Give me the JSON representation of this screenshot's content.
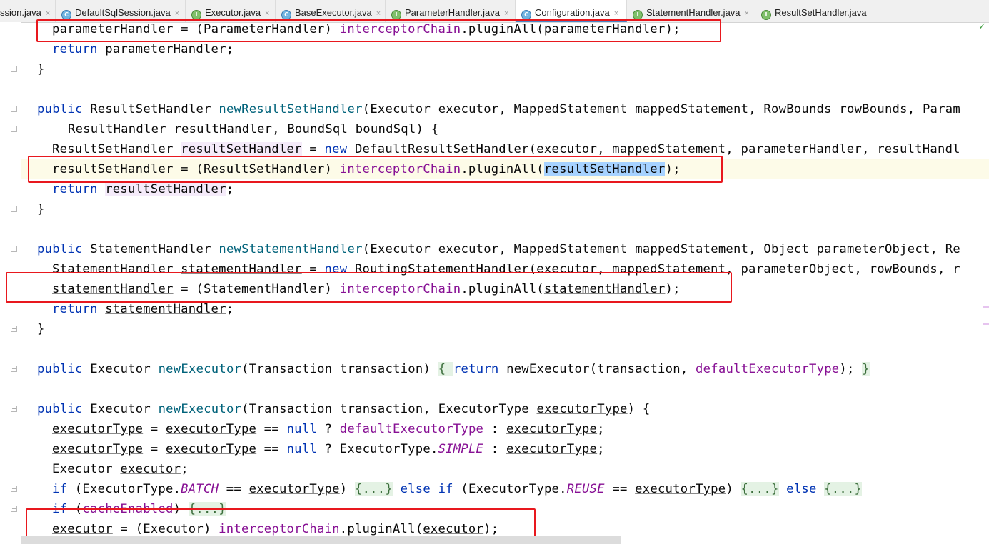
{
  "tabs": [
    {
      "label": "ssion.java",
      "type": "class",
      "active": false
    },
    {
      "label": "DefaultSqlSession.java",
      "type": "class",
      "active": false
    },
    {
      "label": "Executor.java",
      "type": "interface",
      "active": false
    },
    {
      "label": "BaseExecutor.java",
      "type": "class",
      "active": false
    },
    {
      "label": "ParameterHandler.java",
      "type": "interface",
      "active": false
    },
    {
      "label": "Configuration.java",
      "type": "class",
      "active": true
    },
    {
      "label": "StatementHandler.java",
      "type": "interface",
      "active": false
    },
    {
      "label": "ResultSetHandler.java",
      "type": "interface",
      "active": false
    }
  ],
  "icons": {
    "class_glyph": "C",
    "interface_glyph": "I",
    "close_glyph": "×",
    "check_glyph": "✓"
  },
  "colors": {
    "keyword": "#0033b3",
    "method": "#00627a",
    "field": "#871094",
    "highlight_box": "#e8181e",
    "active_tab": "#4a88c7"
  },
  "code": {
    "l1": {
      "a": "parameterHandler",
      "b": " = (ParameterHandler) ",
      "c": "interceptorChain",
      "d": ".pluginAll(",
      "e": "parameterHandler",
      "f": ");"
    },
    "l2": {
      "a": "return ",
      "b": "parameterHandler",
      "c": ";"
    },
    "l3": {
      "a": "}"
    },
    "l4": {
      "a": "public ",
      "b": "ResultSetHandler ",
      "c": "newResultSetHandler",
      "d": "(Executor executor, MappedStatement mappedStatement, RowBounds rowBounds, Param"
    },
    "l5": {
      "a": "ResultHandler resultHandler, BoundSql boundSql) {"
    },
    "l6": {
      "a": "ResultSetHandler ",
      "b": "resultSetHandler",
      "c": " = ",
      "d": "new ",
      "e": "DefaultResultSetHandler(executor, mappedStatement, parameterHandler, resultHandl"
    },
    "l7": {
      "a": "resultSetHandler",
      "b": " = (ResultSetHandler) ",
      "c": "interceptorChain",
      "d": ".pluginAll(",
      "e": "resultSetHandler",
      "f": ");"
    },
    "l8": {
      "a": "return ",
      "b": "resultSetHandler",
      "c": ";"
    },
    "l9": {
      "a": "}"
    },
    "l10": {
      "a": "public ",
      "b": "StatementHandler ",
      "c": "newStatementHandler",
      "d": "(Executor executor, MappedStatement mappedStatement, Object parameterObject, Re"
    },
    "l11": {
      "a": "StatementHandler ",
      "b": "statementHandler",
      "c": " = ",
      "d": "new ",
      "e": "RoutingStatementHandler(executor, mappedStatement, parameterObject, rowBounds, r"
    },
    "l12": {
      "a": "statementHandler",
      "b": " = (StatementHandler) ",
      "c": "interceptorChain",
      "d": ".pluginAll(",
      "e": "statementHandler",
      "f": ");"
    },
    "l13": {
      "a": "return ",
      "b": "statementHandler",
      "c": ";"
    },
    "l14": {
      "a": "}"
    },
    "l15": {
      "a": "public ",
      "b": "Executor ",
      "c": "newExecutor",
      "d": "(Transaction transaction) ",
      "e": "{ ",
      "f": "return ",
      "g": "newExecutor(transaction, ",
      "h": "defaultExecutorType",
      "i": "); ",
      "j": "}"
    },
    "l16": {
      "a": "public ",
      "b": "Executor ",
      "c": "newExecutor",
      "d": "(Transaction transaction, ExecutorType ",
      "e": "executorType",
      "f": ") {"
    },
    "l17": {
      "a": "executorType",
      "b": " = ",
      "c": "executorType",
      "d": " == ",
      "e": "null",
      "f": " ? ",
      "g": "defaultExecutorType",
      "h": " : ",
      "i": "executorType",
      "j": ";"
    },
    "l18": {
      "a": "executorType",
      "b": " = ",
      "c": "executorType",
      "d": " == ",
      "e": "null",
      "f": " ? ExecutorType.",
      "g": "SIMPLE",
      "h": " : ",
      "i": "executorType",
      "j": ";"
    },
    "l19": {
      "a": "Executor ",
      "b": "executor",
      "c": ";"
    },
    "l20": {
      "a": "if ",
      "b": "(ExecutorType.",
      "c": "BATCH",
      "d": " == ",
      "e": "executorType",
      "f": ") ",
      "g": "{...}",
      "h": " ",
      "i": "else if ",
      "j": "(ExecutorType.",
      "k": "REUSE",
      "l": " == ",
      "m": "executorType",
      "n": ") ",
      "o": "{...}",
      "p": " ",
      "q": "else ",
      "r": "{...}"
    },
    "l21": {
      "a": "if ",
      "b": "(",
      "c": "cacheEnabled",
      "d": ") ",
      "e": "{...}"
    },
    "l22": {
      "a": "executor",
      "b": " = (Executor) ",
      "c": "interceptorChain",
      "d": ".pluginAll(",
      "e": "executor",
      "f": ");"
    }
  }
}
